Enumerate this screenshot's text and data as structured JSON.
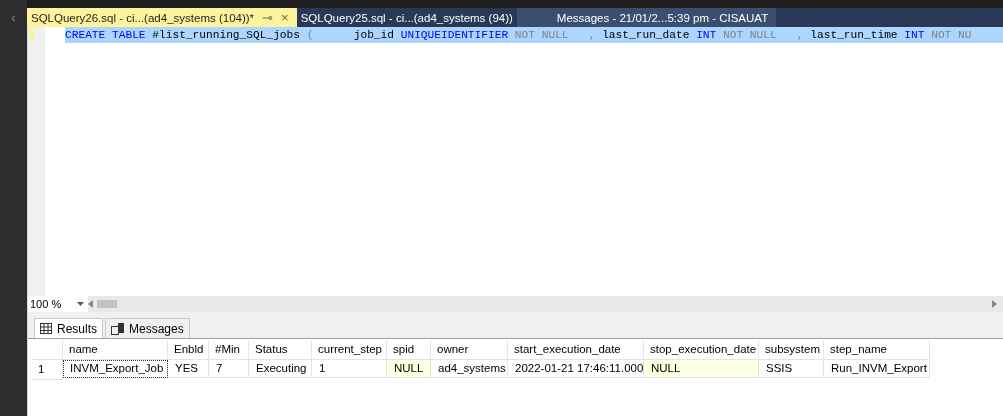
{
  "side_panel": {
    "collapse": "‹"
  },
  "tabs": [
    {
      "label": "SQLQuery26.sql - ci...(ad4_systems (104))*",
      "selected": true,
      "pin": "⊸",
      "close": "×"
    },
    {
      "label": "SQLQuery25.sql - ci...(ad4_systems (94))",
      "selected": false
    },
    {
      "label": "Messages - 21/01/2...5:39 pm - CISAUAT",
      "selected": false
    }
  ],
  "editor": {
    "tokens": [
      {
        "kind": "keyword",
        "text": "CREATE TABLE"
      },
      {
        "kind": "plain",
        "text": " #list_running_SQL_jobs "
      },
      {
        "kind": "gray",
        "text": "(      "
      },
      {
        "kind": "plain",
        "text": "job_id "
      },
      {
        "kind": "keyword",
        "text": "UNIQUEIDENTIFIER"
      },
      {
        "kind": "gray",
        "text": " NOT NULL   , "
      },
      {
        "kind": "plain",
        "text": "last_run_date "
      },
      {
        "kind": "keyword",
        "text": "INT"
      },
      {
        "kind": "gray",
        "text": " NOT NULL   , "
      },
      {
        "kind": "plain",
        "text": "last_run_time "
      },
      {
        "kind": "keyword",
        "text": "INT"
      },
      {
        "kind": "gray",
        "text": " NOT NU"
      }
    ]
  },
  "zoom": {
    "value": "100 %"
  },
  "result_tabs": [
    {
      "label": "Results",
      "selected": true
    },
    {
      "label": "Messages",
      "selected": false
    }
  ],
  "grid": {
    "columns": [
      "name",
      "Enbld",
      "#Min",
      "Status",
      "current_step",
      "spid",
      "owner",
      "start_execution_date",
      "stop_execution_date",
      "subsystem",
      "step_name"
    ],
    "rows": [
      {
        "number": "1",
        "cells": [
          {
            "text": "INVM_Export_Job",
            "null": false,
            "focused": true
          },
          {
            "text": "YES",
            "null": false,
            "focused": false
          },
          {
            "text": "7",
            "null": false,
            "focused": false
          },
          {
            "text": "Executing",
            "null": false,
            "focused": false
          },
          {
            "text": "1",
            "null": false,
            "focused": false
          },
          {
            "text": "NULL",
            "null": true,
            "focused": false
          },
          {
            "text": "ad4_systems",
            "null": false,
            "focused": false
          },
          {
            "text": "2022-01-21 17:46:11.000",
            "null": false,
            "focused": false
          },
          {
            "text": "NULL",
            "null": true,
            "focused": false
          },
          {
            "text": "SSIS",
            "null": false,
            "focused": false
          },
          {
            "text": "Run_INVM_Export",
            "null": false,
            "focused": false
          }
        ]
      }
    ]
  }
}
